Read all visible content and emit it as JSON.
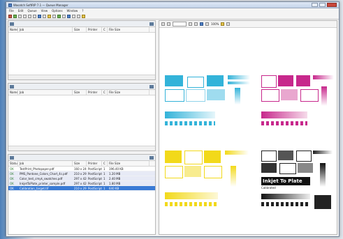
{
  "window": {
    "title": "Wasatch SoftRIP 7.1 — Queue Manager"
  },
  "menu": [
    "File",
    "Edit",
    "Queue",
    "View",
    "Options",
    "Window",
    "?"
  ],
  "panes": [
    {
      "columns": [
        "Name",
        "Job",
        "Size",
        "Printer",
        "C",
        "File Size"
      ],
      "rows": []
    },
    {
      "columns": [
        "Name",
        "Job",
        "Size",
        "Printer",
        "C",
        "File Size"
      ],
      "rows": []
    },
    {
      "columns": [
        "Status",
        "Job",
        "Size",
        "Printer",
        "C",
        "File Size"
      ],
      "rows": [
        {
          "status": "OK",
          "job": "TestPrint_Photopaper.pdf",
          "size": "160 x 240",
          "printer": "PostScript",
          "c": "1",
          "file_size": "196.40 KB"
        },
        {
          "status": "OK",
          "job": "PMS_Pantone_Colors_Chart_4c.pdf",
          "size": "210 x 297",
          "printer": "PostScript",
          "c": "1",
          "file_size": "1.20 MB"
        },
        {
          "status": "OK",
          "job": "Color_test_cmyk_swatches.pdf",
          "size": "297 x 420",
          "printer": "PostScript",
          "c": "1",
          "file_size": "2.40 MB"
        },
        {
          "status": "OK",
          "job": "InkjetToPlate_printer_sample.pdf",
          "size": "297 x 420",
          "printer": "PostScript",
          "c": "1",
          "file_size": "1.80 MB"
        },
        {
          "status": "OK",
          "job": "Calibration_target.tif",
          "size": "210 x 297",
          "printer": "PostScript",
          "c": "1",
          "file_size": "640 KB"
        }
      ]
    }
  ],
  "preview": {
    "zoom": "100%",
    "sample_text": "Inkjet To Plate",
    "sample_subtext": "Calibrated"
  },
  "colors": {
    "cyan": "#33b3d9",
    "magenta": "#c7288c",
    "yellow": "#f2d91a",
    "black": "#222222",
    "selection": "#3a7bd5"
  }
}
